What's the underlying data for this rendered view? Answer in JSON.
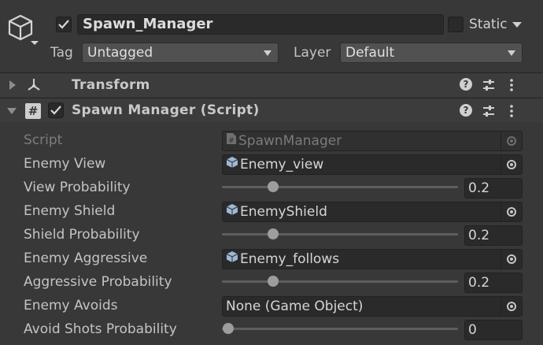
{
  "header": {
    "object_name": "Spawn_Manager",
    "active_checked": true,
    "static_label": "Static",
    "tag_label": "Tag",
    "tag_value": "Untagged",
    "layer_label": "Layer",
    "layer_value": "Default"
  },
  "components": {
    "transform": {
      "title": "Transform"
    },
    "script": {
      "title": "Spawn Manager (Script)",
      "enabled": true
    }
  },
  "fields": {
    "script": {
      "label": "Script",
      "value": "SpawnManager"
    },
    "enemy_view": {
      "label": "Enemy View",
      "value": "Enemy_view"
    },
    "view_prob": {
      "label": "View Probability",
      "value": "0.2",
      "fraction": 0.2
    },
    "enemy_shield": {
      "label": "Enemy Shield",
      "value": "EnemyShield"
    },
    "shield_prob": {
      "label": "Shield Probability",
      "value": "0.2",
      "fraction": 0.2
    },
    "enemy_aggressive": {
      "label": "Enemy Aggressive",
      "value": "Enemy_follows"
    },
    "aggr_prob": {
      "label": "Aggressive Probability",
      "value": "0.2",
      "fraction": 0.2
    },
    "enemy_avoids": {
      "label": "Enemy Avoids",
      "value": "None (Game Object)"
    },
    "avoid_prob": {
      "label": "Avoid Shots Probability",
      "value": "0",
      "fraction": 0
    }
  },
  "icons": {
    "object": "cube-icon",
    "transform": "transform-axes-icon",
    "script": "script-hash-icon",
    "help": "help-icon",
    "presets": "presets-icon",
    "menu": "kebab-menu-icon",
    "prefab": "prefab-cube-icon",
    "picker": "object-picker-icon"
  },
  "colors": {
    "background": "#383838",
    "field": "#2a2a2a",
    "dropdown": "#515151",
    "text": "#c4c4c4",
    "slider_thumb": "#9d9d9d"
  }
}
